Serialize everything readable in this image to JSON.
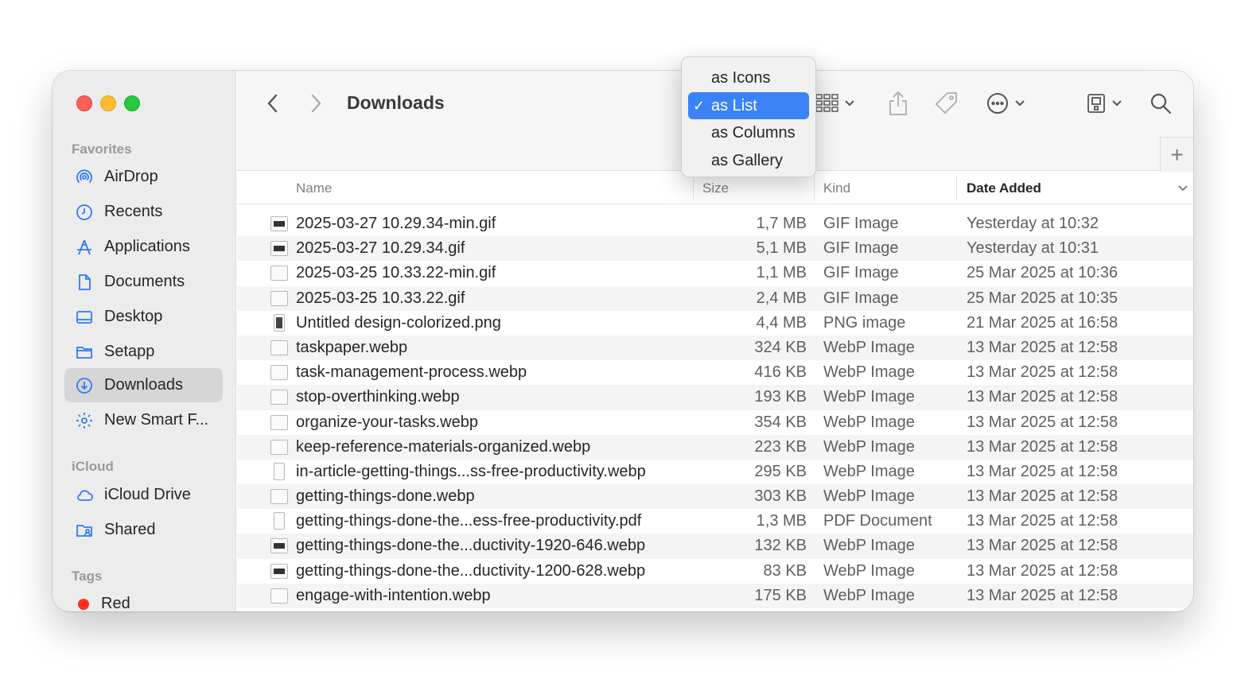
{
  "window": {
    "title": "Downloads"
  },
  "sidebar": {
    "sections": [
      {
        "label": "Favorites"
      },
      {
        "label": "iCloud"
      },
      {
        "label": "Tags"
      }
    ],
    "items": [
      {
        "label": "AirDrop",
        "icon": "airdrop-icon"
      },
      {
        "label": "Recents",
        "icon": "clock-icon"
      },
      {
        "label": "Applications",
        "icon": "applications-icon"
      },
      {
        "label": "Documents",
        "icon": "document-icon"
      },
      {
        "label": "Desktop",
        "icon": "desktop-icon"
      },
      {
        "label": "Setapp",
        "icon": "folder-icon"
      },
      {
        "label": "Downloads",
        "icon": "download-icon",
        "active": true
      },
      {
        "label": "New Smart F...",
        "icon": "gear-icon"
      },
      {
        "label": "iCloud Drive",
        "icon": "cloud-icon"
      },
      {
        "label": "Shared",
        "icon": "shared-folder-icon"
      },
      {
        "label": "Red",
        "icon": "tag-dot-icon",
        "color": "#ff2d20"
      }
    ]
  },
  "view_menu": {
    "items": [
      {
        "label": "as Icons"
      },
      {
        "label": "as List",
        "selected": true
      },
      {
        "label": "as Columns"
      },
      {
        "label": "as Gallery"
      }
    ]
  },
  "columns": {
    "name": "Name",
    "size": "Size",
    "kind": "Kind",
    "date_added": "Date Added"
  },
  "files": [
    {
      "name": "2025-03-27 10.29.34-min.gif",
      "size": "1,7 MB",
      "kind": "GIF Image",
      "date": "Yesterday at 10:32"
    },
    {
      "name": "2025-03-27 10.29.34.gif",
      "size": "5,1 MB",
      "kind": "GIF Image",
      "date": "Yesterday at 10:31"
    },
    {
      "name": "2025-03-25 10.33.22-min.gif",
      "size": "1,1 MB",
      "kind": "GIF Image",
      "date": "25 Mar 2025 at 10:36"
    },
    {
      "name": "2025-03-25 10.33.22.gif",
      "size": "2,4 MB",
      "kind": "GIF Image",
      "date": "25 Mar 2025 at 10:35"
    },
    {
      "name": "Untitled design-colorized.png",
      "size": "4,4 MB",
      "kind": "PNG image",
      "date": "21 Mar 2025 at 16:58"
    },
    {
      "name": "taskpaper.webp",
      "size": "324 KB",
      "kind": "WebP Image",
      "date": "13 Mar 2025 at 12:58"
    },
    {
      "name": "task-management-process.webp",
      "size": "416 KB",
      "kind": "WebP Image",
      "date": "13 Mar 2025 at 12:58"
    },
    {
      "name": "stop-overthinking.webp",
      "size": "193 KB",
      "kind": "WebP Image",
      "date": "13 Mar 2025 at 12:58"
    },
    {
      "name": "organize-your-tasks.webp",
      "size": "354 KB",
      "kind": "WebP Image",
      "date": "13 Mar 2025 at 12:58"
    },
    {
      "name": "keep-reference-materials-organized.webp",
      "size": "223 KB",
      "kind": "WebP Image",
      "date": "13 Mar 2025 at 12:58"
    },
    {
      "name": "in-article-getting-things...ss-free-productivity.webp",
      "size": "295 KB",
      "kind": "WebP Image",
      "date": "13 Mar 2025 at 12:58"
    },
    {
      "name": "getting-things-done.webp",
      "size": "303 KB",
      "kind": "WebP Image",
      "date": "13 Mar 2025 at 12:58"
    },
    {
      "name": "getting-things-done-the...ess-free-productivity.pdf",
      "size": "1,3 MB",
      "kind": "PDF Document",
      "date": "13 Mar 2025 at 12:58"
    },
    {
      "name": "getting-things-done-the...ductivity-1920-646.webp",
      "size": "132 KB",
      "kind": "WebP Image",
      "date": "13 Mar 2025 at 12:58"
    },
    {
      "name": "getting-things-done-the...ductivity-1200-628.webp",
      "size": "83 KB",
      "kind": "WebP Image",
      "date": "13 Mar 2025 at 12:58"
    },
    {
      "name": "engage-with-intention.webp",
      "size": "175 KB",
      "kind": "WebP Image",
      "date": "13 Mar 2025 at 12:58"
    }
  ],
  "colors": {
    "accent": "#3b82f7",
    "sidebar_icon": "#2f7cf6",
    "close": "#fe5f57",
    "minimize": "#febc2e",
    "zoom": "#28c840"
  }
}
